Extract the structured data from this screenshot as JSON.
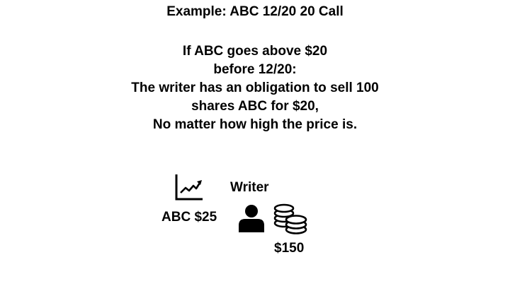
{
  "slide": {
    "title": "Example: ABC 12/20 20 Call",
    "lines": [
      "If ABC goes above $20",
      "before 12/20:",
      "The writer has an obligation to sell 100",
      "shares ABC for $20,",
      "No matter how high the price is."
    ],
    "stock_label": "ABC $25",
    "writer_label": "Writer",
    "amount_label": "$150"
  },
  "icons": {
    "chart": "line-chart-trending-up-icon",
    "person": "person-icon",
    "coins": "coin-stack-icon"
  }
}
